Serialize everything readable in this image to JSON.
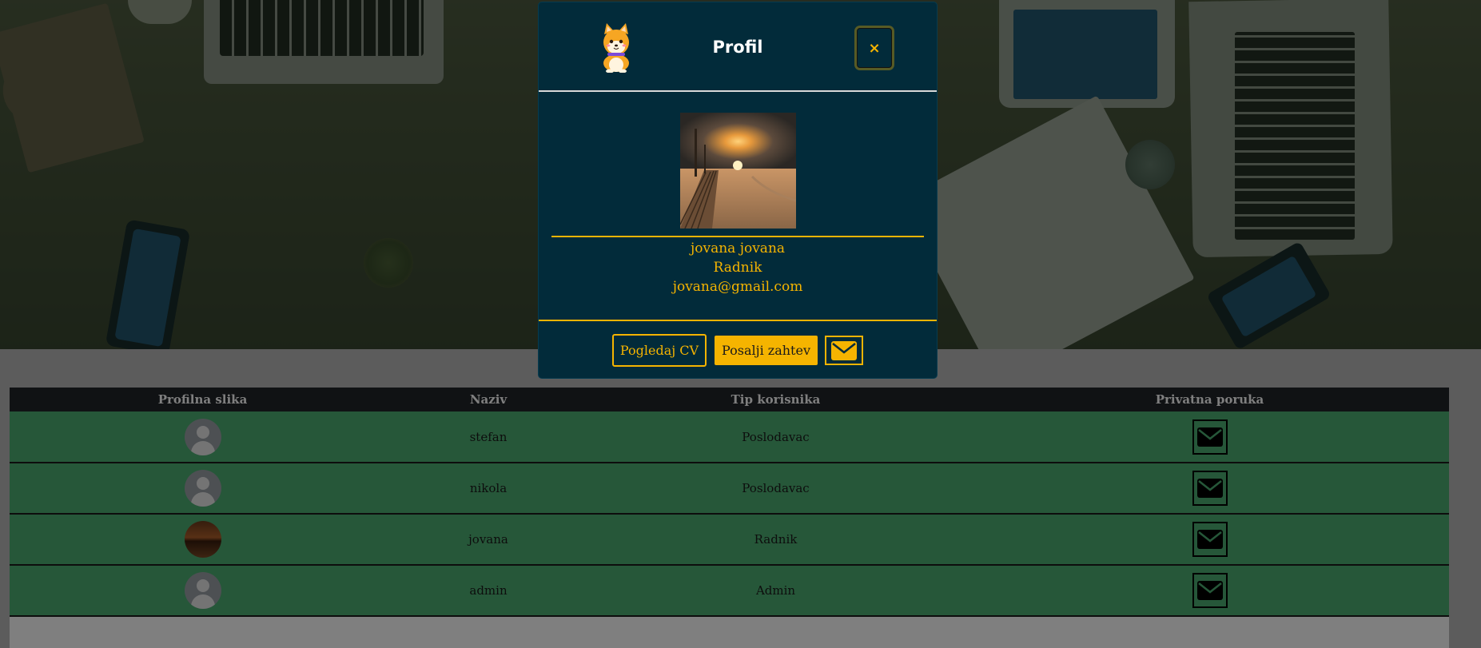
{
  "modal": {
    "title": "Profil",
    "close_label": "×",
    "user": {
      "full_name": "jovana jovana",
      "role": "Radnik",
      "email": "jovana@gmail.com"
    },
    "buttons": {
      "view_cv": "Pogledaj CV",
      "send_request": "Posalji zahtev",
      "message_icon": "envelope-icon"
    }
  },
  "table": {
    "headers": [
      "Profilna slika",
      "Naziv",
      "Tip korisnika",
      "Privatna poruka"
    ],
    "rows": [
      {
        "avatar": "default-avatar",
        "name": "stefan",
        "type": "Poslodavac",
        "action_icon": "envelope-icon"
      },
      {
        "avatar": "default-avatar",
        "name": "nikola",
        "type": "Poslodavac",
        "action_icon": "envelope-icon"
      },
      {
        "avatar": "photo-avatar",
        "name": "jovana",
        "type": "Radnik",
        "action_icon": "envelope-icon"
      },
      {
        "avatar": "default-avatar",
        "name": "admin",
        "type": "Admin",
        "action_icon": "envelope-icon"
      }
    ]
  },
  "colors": {
    "modal_bg": "#022b3a",
    "accent_gold": "#f5b400",
    "row_green": "#4caf72",
    "header_dark": "#212529"
  }
}
